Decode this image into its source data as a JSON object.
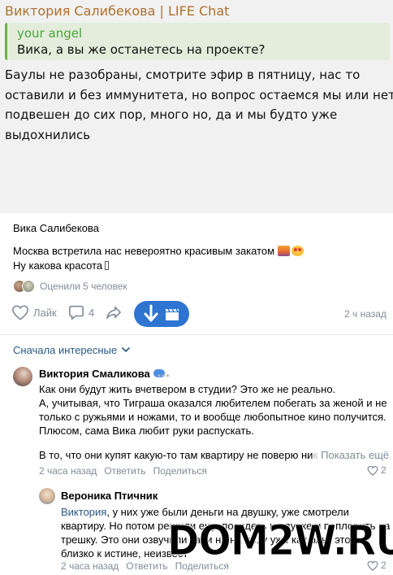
{
  "telegram": {
    "title": "Виктория Салибекова | LIFE Chat",
    "quote_author": "your angel",
    "quote_text": "Вика, а вы же останетесь на проекте?",
    "message_lines": [
      "Баулы не разобраны, смотрите эфир в пятницу, нас то",
      "оставили и без иммунитета, но вопрос остаемся мы или нет",
      "подвешен до сих пор, много но, да и мы будто уже",
      "выдохнились"
    ]
  },
  "post": {
    "author": "Вика Салибекова",
    "text_line1": "Москва встретила нас невероятно красивым закатом",
    "text_line2": "Ну какова красота",
    "likers_text": "Оценили 5 человек",
    "like_label": "Лайк",
    "comment_count": "4",
    "time": "2 ч назад",
    "icons": [
      "heart-icon",
      "comment-icon",
      "share-icon",
      "download-arrow-icon",
      "clapperboard-icon"
    ],
    "accent_color": "#2e74d1"
  },
  "sort": {
    "label": "Сначала интересные"
  },
  "comments": [
    {
      "author": "Виктория Смаликова",
      "lines": [
        "Как они будут жить вчетвером в студии? Это же не реально.",
        "А, учитывая, что Тиграша оказался любителем побегать за женой и не",
        "только с ружьями и ножами, то и вообще любопытное кино получится.",
        "Плюсом, сама Вика любит руки распускать."
      ],
      "tail_visible": "В то, что они купят какую-то там квартиру не поверю ни",
      "tail_faded": "к",
      "show_more": "Показать ещё",
      "time": "2 часа назад",
      "reply_label": "Ответить",
      "share_label": "Поделиться",
      "likes": "2"
    },
    {
      "author": "Вероника Птичник",
      "reply_to": "Виктория",
      "lines": [
        ", у них уже были деньги на двушку, уже смотрели",
        "квартиру. Но потом решили еще посидеть на дурке и поплорить на",
        "трешку. Это они озвучили тани на на не. у уже как ольк это",
        "близко к истине, неизвест"
      ],
      "time": "2 часа назад",
      "reply_label": "Ответить",
      "share_label": "Поделиться",
      "likes": "2"
    }
  ],
  "watermark": "DOM2W.RU"
}
